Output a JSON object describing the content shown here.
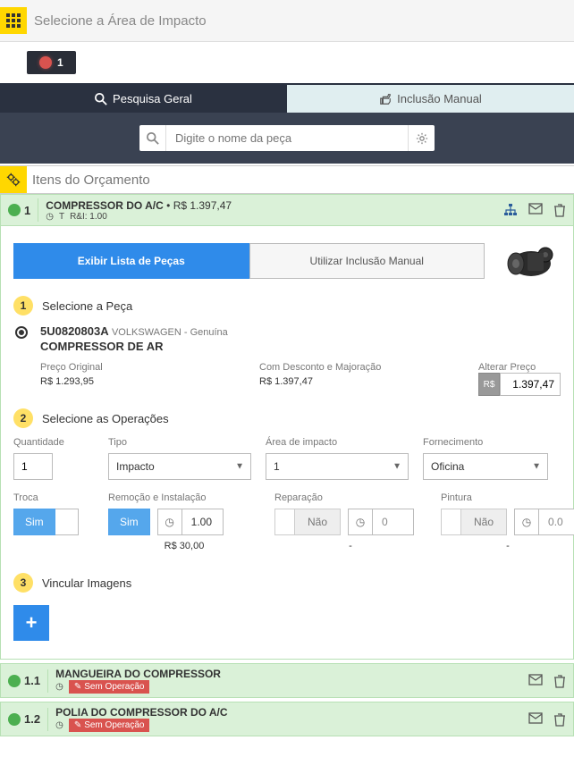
{
  "header": {
    "title": "Selecione a Área de Impacto",
    "indicator": "1"
  },
  "tabs": {
    "search": "Pesquisa Geral",
    "manual": "Inclusão Manual"
  },
  "search": {
    "placeholder": "Digite o nome da peça"
  },
  "section": {
    "title": "Itens do Orçamento"
  },
  "item1": {
    "num": "1",
    "title": "COMPRESSOR DO A/C",
    "price": "R$ 1.397,47",
    "meta_t": "T",
    "meta_ri": "R&I: 1.00",
    "subtabs": {
      "list": "Exibir Lista de Peças",
      "manual": "Utilizar Inclusão Manual"
    },
    "step1": {
      "num": "1",
      "label": "Selecione a Peça"
    },
    "part": {
      "code": "5U0820803A",
      "make": "VOLKSWAGEN - Genuína",
      "desc": "COMPRESSOR DE AR"
    },
    "prices": {
      "orig_label": "Preço Original",
      "orig_val": "R$ 1.293,95",
      "disc_label": "Com Desconto e Majoração",
      "disc_val": "R$ 1.397,47",
      "alter_label": "Alterar Preço",
      "rs": "R$",
      "alter_val": "1.397,47"
    },
    "step2": {
      "num": "2",
      "label": "Selecione as Operações"
    },
    "ops": {
      "qty_label": "Quantidade",
      "qty_val": "1",
      "type_label": "Tipo",
      "type_val": "Impacto",
      "area_label": "Área de impacto",
      "area_val": "1",
      "supply_label": "Fornecimento",
      "supply_val": "Oficina",
      "troca_label": "Troca",
      "sim": "Sim",
      "nao": "Não",
      "remi_label": "Remoção e Instalação",
      "remi_time": "1.00",
      "remi_price": "R$ 30,00",
      "rep_label": "Reparação",
      "rep_time": "0",
      "rep_sub": "-",
      "pint_label": "Pintura",
      "pint_time": "0.0",
      "pint_sub": "-"
    },
    "step3": {
      "num": "3",
      "label": "Vincular Imagens"
    }
  },
  "item11": {
    "num": "1.1",
    "title": "MANGUEIRA DO COMPRESSOR",
    "badge": "Sem Operação"
  },
  "item12": {
    "num": "1.2",
    "title": "POLIA DO COMPRESSOR DO A/C",
    "badge": "Sem Operação"
  }
}
